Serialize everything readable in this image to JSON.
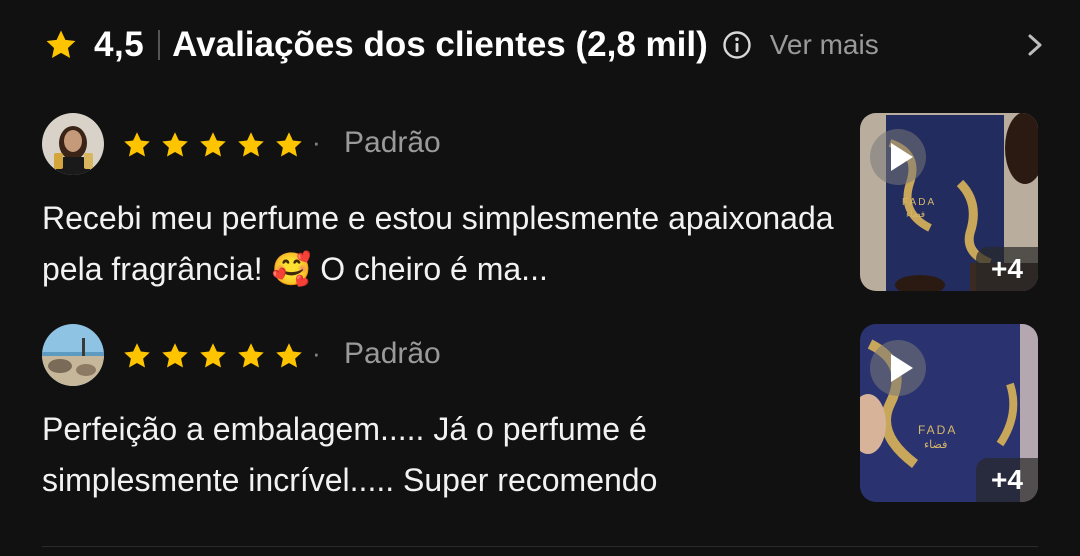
{
  "header": {
    "rating": "4,5",
    "title": "Avaliações dos clientes (2,8 mil)",
    "see_more": "Ver mais",
    "icons": {
      "star": "star-icon",
      "info": "info-icon",
      "chevron": "chevron-right-icon"
    }
  },
  "colors": {
    "star": "#FFC400",
    "background": "#111111",
    "muted_text": "#9A9A9A"
  },
  "reviews": [
    {
      "stars": 5,
      "separator": "·",
      "variant": "Padrão",
      "text": "Recebi meu perfume e estou simplesmente apaixonada pela fragrância! 🥰 O cheiro é ma...",
      "media_count": "+4"
    },
    {
      "stars": 5,
      "separator": "·",
      "variant": "Padrão",
      "text": "Perfeição a embalagem..... Já o perfume é simplesmente incrível..... Super recomendo",
      "media_count": "+4"
    }
  ]
}
